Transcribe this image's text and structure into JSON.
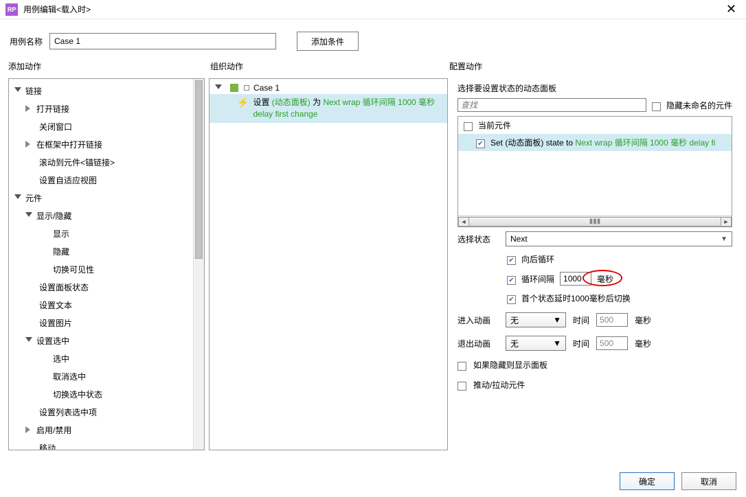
{
  "window": {
    "title": "用例编辑<载入时>",
    "rp": "RP"
  },
  "nameRow": {
    "label": "用例名称",
    "value": "Case 1",
    "addCondition": "添加条件"
  },
  "headers": {
    "left": "添加动作",
    "mid": "组织动作",
    "right": "配置动作"
  },
  "actionsTree": [
    {
      "label": "链接",
      "indent": 0,
      "tri": "down"
    },
    {
      "label": "打开链接",
      "indent": 1,
      "tri": "right"
    },
    {
      "label": "关闭窗口",
      "indent": 1,
      "tri": "none"
    },
    {
      "label": "在框架中打开链接",
      "indent": 1,
      "tri": "right"
    },
    {
      "label": "滚动到元件<锚链接>",
      "indent": 1,
      "tri": "none"
    },
    {
      "label": "设置自适应视图",
      "indent": 1,
      "tri": "none"
    },
    {
      "label": "元件",
      "indent": 0,
      "tri": "down"
    },
    {
      "label": "显示/隐藏",
      "indent": 1,
      "tri": "down"
    },
    {
      "label": "显示",
      "indent": 2,
      "tri": "none"
    },
    {
      "label": "隐藏",
      "indent": 2,
      "tri": "none"
    },
    {
      "label": "切换可见性",
      "indent": 2,
      "tri": "none"
    },
    {
      "label": "设置面板状态",
      "indent": 1,
      "tri": "none"
    },
    {
      "label": "设置文本",
      "indent": 1,
      "tri": "none"
    },
    {
      "label": "设置图片",
      "indent": 1,
      "tri": "none"
    },
    {
      "label": "设置选中",
      "indent": 1,
      "tri": "down"
    },
    {
      "label": "选中",
      "indent": 2,
      "tri": "none"
    },
    {
      "label": "取消选中",
      "indent": 2,
      "tri": "none"
    },
    {
      "label": "切换选中状态",
      "indent": 2,
      "tri": "none"
    },
    {
      "label": "设置列表选中项",
      "indent": 1,
      "tri": "none"
    },
    {
      "label": "启用/禁用",
      "indent": 1,
      "tri": "right"
    },
    {
      "label": "移动",
      "indent": 1,
      "tri": "none"
    }
  ],
  "organize": {
    "caseLabel": "Case 1",
    "actionPrefix": "设置 ",
    "actionGreen1": "(动态面板)",
    "actionMid": " 为 ",
    "actionGreen2": "Next wrap 循环间隔 1000 毫秒 delay first change"
  },
  "config": {
    "selectPanelLabel": "选择要设置状态的动态面板",
    "searchPlaceholder": "查找",
    "hideUnnamed": "隐藏未命名的元件",
    "row1": "当前元件",
    "row2Prefix": "Set (动态面板) state to ",
    "row2Green": "Next wrap 循环间隔 1000 毫秒 delay fi",
    "selectStateLabel": "选择状态",
    "selectStateValue": "Next",
    "wrapLabel": "向后循环",
    "intervalLabel": "循环间隔",
    "intervalValue": "1000",
    "msLabel": "毫秒",
    "delayLabel": "首个状态延时1000毫秒后切换",
    "animInLabel": "进入动画",
    "animOutLabel": "退出动画",
    "animNone": "无",
    "timeLabel": "时间",
    "timeValue": "500",
    "showIfHidden": "如果隐藏则显示面板",
    "pushPull": "推动/拉动元件"
  },
  "footer": {
    "ok": "确定",
    "cancel": "取消"
  }
}
